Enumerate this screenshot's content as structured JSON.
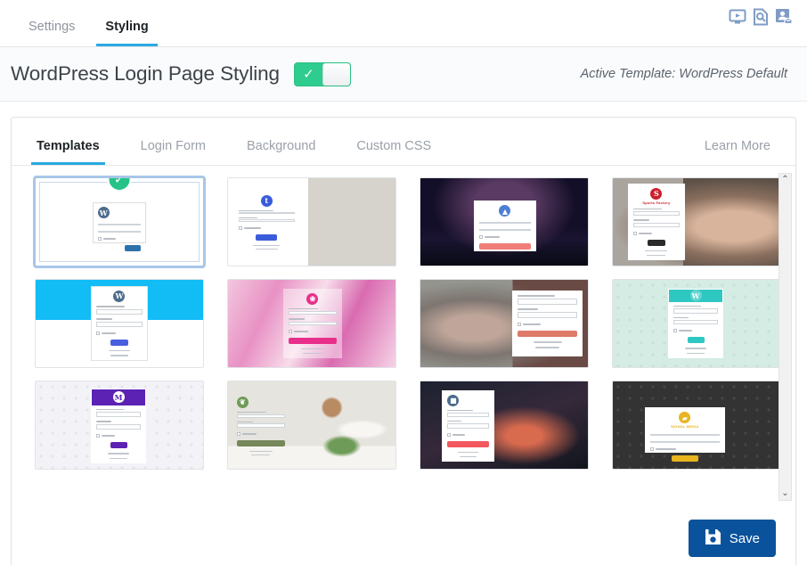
{
  "topbar": {
    "tabs": [
      {
        "label": "Settings",
        "active": false
      },
      {
        "label": "Styling",
        "active": true
      }
    ],
    "icons": [
      {
        "name": "video-tutorial-icon"
      },
      {
        "name": "documentation-search-icon"
      },
      {
        "name": "contact-support-icon"
      }
    ],
    "icon_color": "#7f9cc4"
  },
  "header": {
    "title": "WordPress Login Page Styling",
    "toggle": {
      "state": "on",
      "glyph": "✓",
      "on_color": "#2ecc8f"
    },
    "active_template_text": "Active Template: WordPress Default"
  },
  "panel": {
    "tabs": [
      {
        "label": "Templates",
        "active": true
      },
      {
        "label": "Login Form",
        "active": false
      },
      {
        "label": "Background",
        "active": false
      },
      {
        "label": "Custom CSS",
        "active": false
      }
    ],
    "learn_more": "Learn More",
    "accent_color": "#2ba9e0"
  },
  "templates": [
    {
      "name": "wordpress-default",
      "selected": true,
      "style": "wp-default",
      "button_color": "#2e72aa",
      "logo": "W"
    },
    {
      "name": "split-keyboard",
      "selected": false,
      "style": "split-photo-keyboard",
      "button_color": "#3a5cdb",
      "logo": "t"
    },
    {
      "name": "night-sky",
      "selected": false,
      "style": "night-sky",
      "button_color": "#ef7d78",
      "logo": "▲"
    },
    {
      "name": "sports-factory",
      "selected": false,
      "style": "sports-factory",
      "button_color": "#2b2b2b",
      "logo": "S",
      "brand": "Sports Factory"
    },
    {
      "name": "cyan-band",
      "selected": false,
      "style": "cyan-band",
      "button_color": "#4a5fe0",
      "logo": "W"
    },
    {
      "name": "pink-marble",
      "selected": false,
      "style": "pink-marble",
      "button_color": "#e8308a",
      "logo": "❀"
    },
    {
      "name": "woman-laptop",
      "selected": false,
      "style": "woman-laptop",
      "button_color": "#dd7a68",
      "logo": ""
    },
    {
      "name": "mint-pattern",
      "selected": false,
      "style": "mint-pattern",
      "button_color": "#2fc7c2",
      "logo": "W"
    },
    {
      "name": "purple-header",
      "selected": false,
      "style": "purple-header",
      "button_color": "#5b22b4",
      "logo": "M"
    },
    {
      "name": "minimal-interior",
      "selected": false,
      "style": "minimal-interior",
      "button_color": "#76875a",
      "logo": "❦"
    },
    {
      "name": "city-night",
      "selected": false,
      "style": "city-night",
      "button_color": "#f2575d",
      "logo": "■"
    },
    {
      "name": "signal-media",
      "selected": false,
      "style": "signal-media",
      "button_color": "#e8b420",
      "logo": "▰",
      "brand": "SIGNAL MEDIA"
    }
  ],
  "scrollbar": {
    "up": "⌃",
    "down": "⌄"
  },
  "footer": {
    "save_label": "Save",
    "save_color": "#0a529b",
    "save_icon": "floppy-disk-icon"
  }
}
